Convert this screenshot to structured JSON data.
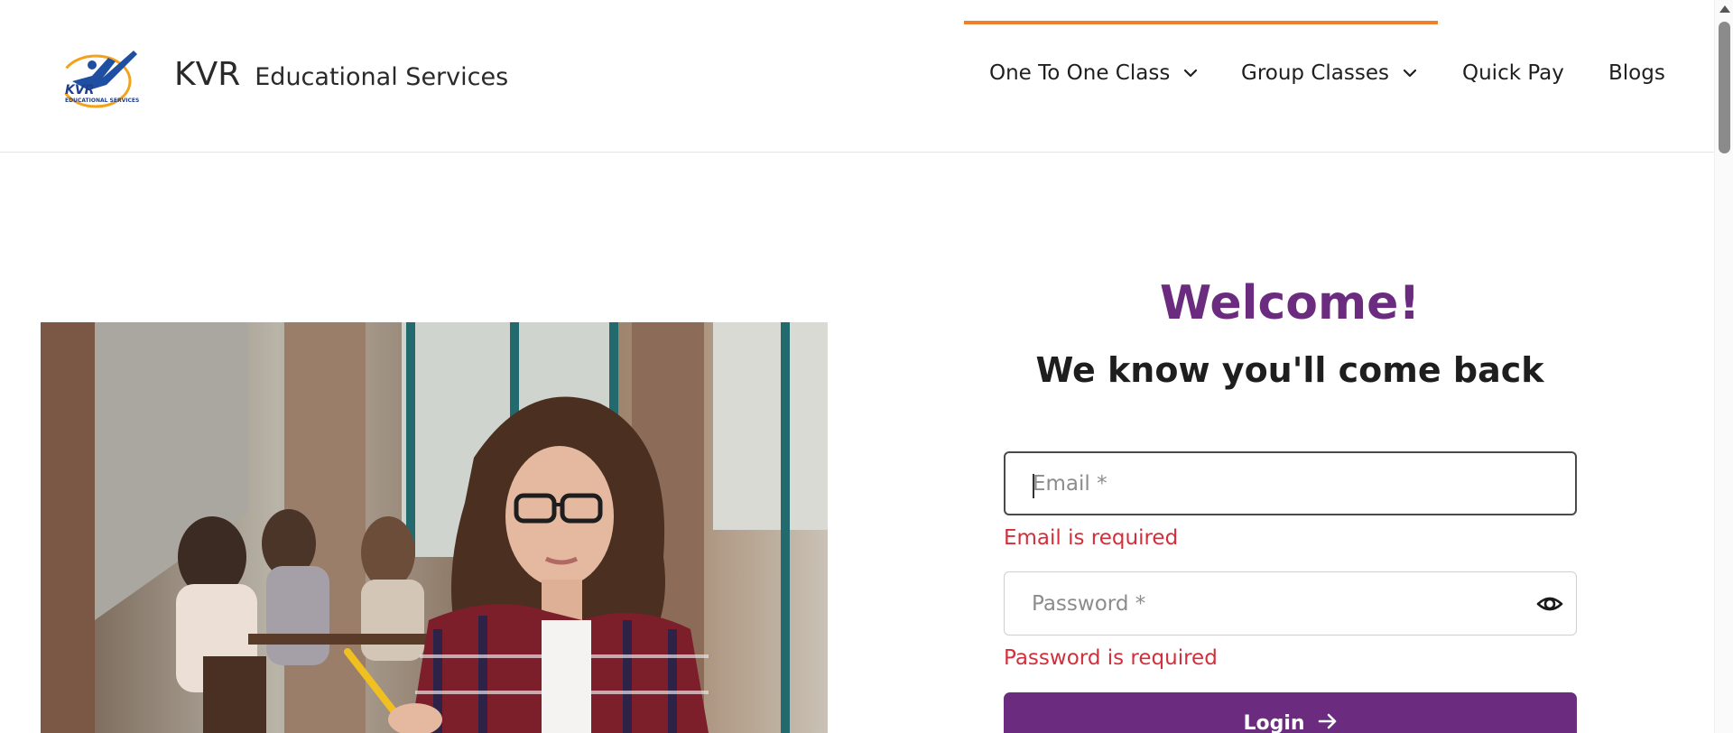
{
  "brand": {
    "name": "KVR",
    "subtitle": "Educational Services",
    "logo_text": "KVR",
    "logo_caption": "EDUCATIONAL SERVICES"
  },
  "nav": {
    "items": [
      {
        "label": "One To One Class",
        "has_dropdown": true,
        "active": true
      },
      {
        "label": "Group Classes",
        "has_dropdown": true,
        "active": false
      },
      {
        "label": "Quick Pay",
        "has_dropdown": false,
        "active": false
      },
      {
        "label": "Blogs",
        "has_dropdown": false,
        "active": false
      }
    ]
  },
  "login": {
    "title": "Welcome!",
    "tagline": "We know you'll come back",
    "email_placeholder": "Email *",
    "email_error": "Email is required",
    "password_placeholder": "Password *",
    "password_error": "Password is required",
    "submit_label": "Login"
  },
  "colors": {
    "brand_purple": "#6b2c7f",
    "accent_orange": "#f07f2b",
    "error_red": "#d32f3b"
  },
  "icons": {
    "nav_dropdown": "chevron-down-icon",
    "password_toggle": "eye-icon",
    "submit_arrow": "arrow-right-icon"
  }
}
